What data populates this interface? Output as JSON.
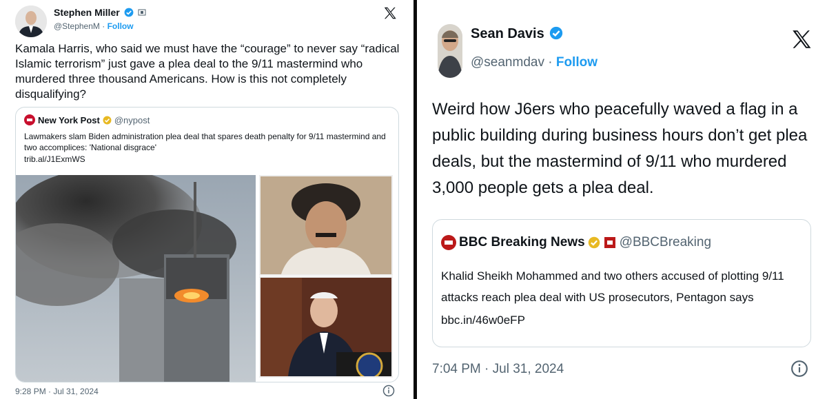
{
  "left_tweet": {
    "author_name": "Stephen Miller",
    "author_handle": "@StephenM",
    "follow_label": "Follow",
    "text": "Kamala Harris, who said we must have the “courage” to never say “radical Islamic terrorism” just gave a plea deal to the 9/11 mastermind who murdered three thousand Americans. How is this not completely disqualifying?",
    "quote": {
      "source_name": "New York Post",
      "source_handle": "@nypost",
      "headline": "Lawmakers slam Biden administration plea deal that spares death penalty for 9/11 mastermind and two accomplices: 'National disgrace'",
      "link": "trib.al/J1ExmWS"
    },
    "timestamp": "9:28 PM · Jul 31, 2024"
  },
  "right_tweet": {
    "author_name": "Sean Davis",
    "author_handle": "@seanmdav",
    "follow_label": "Follow",
    "text": "Weird how J6ers who peacefully waved a flag in a public building during business hours don’t get plea deals, but the mastermind of 9/11 who murdered 3,000 people gets a plea deal.",
    "quote": {
      "source_name": "BBC Breaking News",
      "source_handle": "@BBCBreaking",
      "text": "Khalid Sheikh Mohammed and two others accused of plotting 9/11 attacks reach plea deal with US prosecutors, Pentagon says",
      "link": "bbc.in/46w0eFP"
    },
    "timestamp": "7:04 PM · Jul 31, 2024"
  },
  "icons": {
    "verified": "verified-badge-icon",
    "x_logo": "x-logo-icon",
    "info": "info-icon"
  },
  "colors": {
    "verified_blue": "#1d9bf0",
    "verified_gold": "#e8b923",
    "text": "#0f1419",
    "muted": "#536471",
    "border": "#cfd9de",
    "nypost_red": "#c8102e",
    "bbc_red": "#bb1919"
  }
}
